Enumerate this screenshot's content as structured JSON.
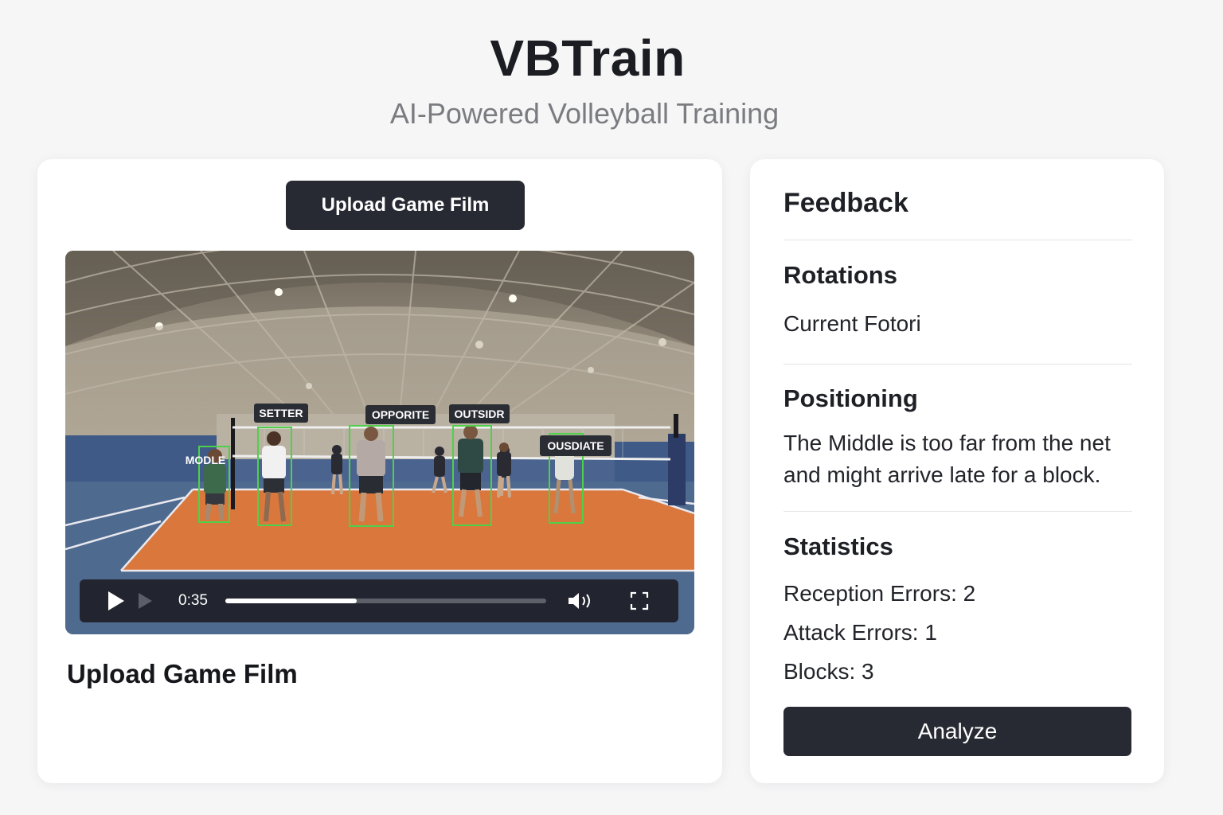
{
  "header": {
    "title": "VBTrain",
    "subtitle": "AI-Powered Volleyball Training"
  },
  "left_panel": {
    "upload_button_label": "Upload Game Film",
    "caption": "Upload Game Film",
    "video": {
      "player_labels": [
        "SETTER",
        "OPPORITE",
        "OUTSIDR",
        "OUSDIATE",
        "MODLE"
      ],
      "player": {
        "current_time": "0:35",
        "progress_fraction": 0.41,
        "icons": [
          "play-icon",
          "next-icon",
          "volume-icon",
          "fullscreen-icon"
        ]
      }
    }
  },
  "feedback": {
    "title": "Feedback",
    "rotations": {
      "heading": "Rotations",
      "text": "Current Fotori"
    },
    "positioning": {
      "heading": "Positioning",
      "text": "The Middle is too far from the net and might arrive late for a block."
    },
    "statistics": {
      "heading": "Statistics",
      "items": [
        "Reception Errors: 2",
        "Attack Errors: 1",
        "Blocks: 3"
      ]
    },
    "analyze_button_label": "Analyze"
  },
  "colors": {
    "button_dark": "#272a33",
    "detection_box": "#4ed14a",
    "court_orange": "#d9773d",
    "court_blue": "#4f6a8f"
  }
}
